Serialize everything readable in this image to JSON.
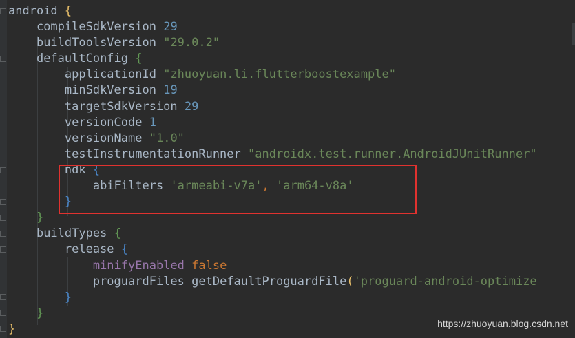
{
  "code": {
    "l1_android": "android",
    "l1_brace": "{",
    "l2_key": "compileSdkVersion",
    "l2_val": "29",
    "l3_key": "buildToolsVersion",
    "l3_val": "\"29.0.2\"",
    "l4_key": "defaultConfig",
    "l4_brace": "{",
    "l5_key": "applicationId",
    "l5_val": "\"zhuoyuan.li.flutterboostexample\"",
    "l6_key": "minSdkVersion",
    "l6_val": "19",
    "l7_key": "targetSdkVersion",
    "l7_val": "29",
    "l8_key": "versionCode",
    "l8_val": "1",
    "l9_key": "versionName",
    "l9_val": "\"1.0\"",
    "l10_key": "testInstrumentationRunner",
    "l10_val": "\"androidx.test.runner.AndroidJUnitRunner\"",
    "l11_key": "ndk",
    "l11_brace": "{",
    "l12_key": "abiFilters",
    "l12_v1": "'armeabi-v7a'",
    "l12_sep": ",",
    "l12_v2": "'arm64-v8a'",
    "l13_brace": "}",
    "l14_brace": "}",
    "l15_key": "buildTypes",
    "l15_brace": "{",
    "l16_key": "release",
    "l16_brace": "{",
    "l17_key": "minifyEnabled",
    "l17_val": "false",
    "l18_key": "proguardFiles",
    "l18_fn": "getDefaultProguardFile",
    "l18_paren": "(",
    "l18_arg": "'proguard-android-optimize",
    "l19_brace": "}",
    "l20_brace": "}",
    "l21_brace": "}"
  },
  "watermark": "https://zhuoyuan.blog.csdn.net",
  "colors": {
    "background": "#2b2b2b",
    "gutter": "#313335",
    "plain_text": "#a9b7c6",
    "number": "#6897bb",
    "string": "#6a8759",
    "property": "#9876aa",
    "keyword": "#cc7832",
    "highlight_box": "#e0322f"
  }
}
